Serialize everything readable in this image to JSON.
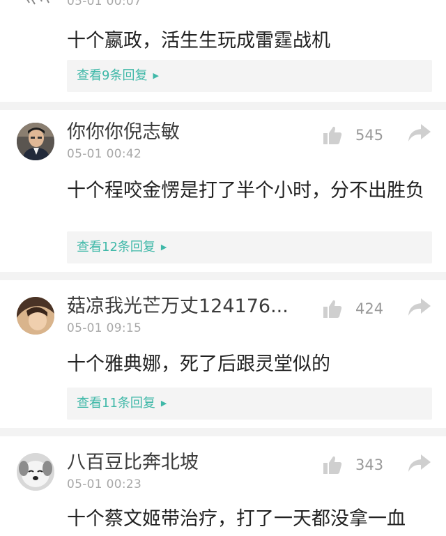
{
  "comments": [
    {
      "time": "05-01 00:07",
      "content": "十个嬴政，活生生玩成雷霆战机",
      "reply_link": "查看9条回复"
    },
    {
      "username": "你你你倪志敏",
      "time": "05-01 00:42",
      "likes": "545",
      "content": "十个程咬金愣是打了半个小时，分不出胜负",
      "reply_link": "查看12条回复"
    },
    {
      "username": "菇凉我光芒万丈124176...",
      "time": "05-01 09:15",
      "likes": "424",
      "content": "十个雅典娜，死了后跟灵堂似的",
      "reply_link": "查看11条回复"
    },
    {
      "username": "八百豆比奔北坡",
      "time": "05-01 00:23",
      "likes": "343",
      "content": "十个蔡文姬带治疗，打了一天都没拿一血"
    }
  ],
  "icons": {
    "like": "thumbs-up-icon",
    "share": "share-arrow-icon",
    "reply_arrow": "chevron-right-icon"
  },
  "colors": {
    "link": "#3fb8a8",
    "icon": "#cfcfcf",
    "meta_text": "#a8a8a8",
    "body_text": "#222222"
  }
}
